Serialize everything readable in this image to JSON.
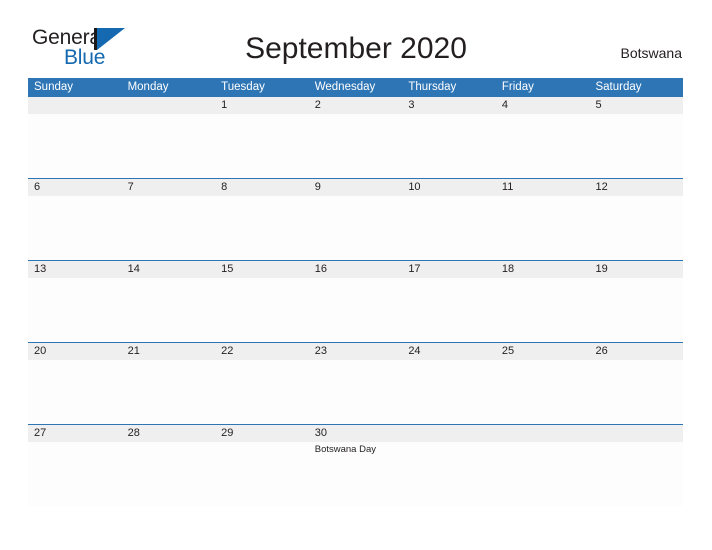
{
  "logo": {
    "word1": "General",
    "word2": "Blue",
    "mark": "triangle-mark",
    "color_dark": "#231f20",
    "color_blue": "#1469b0"
  },
  "header": {
    "title": "September 2020",
    "region": "Botswana"
  },
  "calendar": {
    "accent_color": "#2e75b6",
    "date_band_color": "#efefef",
    "day_names": [
      "Sunday",
      "Monday",
      "Tuesday",
      "Wednesday",
      "Thursday",
      "Friday",
      "Saturday"
    ],
    "weeks": [
      {
        "days": [
          {
            "date": "",
            "event": ""
          },
          {
            "date": "",
            "event": ""
          },
          {
            "date": "1",
            "event": ""
          },
          {
            "date": "2",
            "event": ""
          },
          {
            "date": "3",
            "event": ""
          },
          {
            "date": "4",
            "event": ""
          },
          {
            "date": "5",
            "event": ""
          }
        ]
      },
      {
        "days": [
          {
            "date": "6",
            "event": ""
          },
          {
            "date": "7",
            "event": ""
          },
          {
            "date": "8",
            "event": ""
          },
          {
            "date": "9",
            "event": ""
          },
          {
            "date": "10",
            "event": ""
          },
          {
            "date": "11",
            "event": ""
          },
          {
            "date": "12",
            "event": ""
          }
        ]
      },
      {
        "days": [
          {
            "date": "13",
            "event": ""
          },
          {
            "date": "14",
            "event": ""
          },
          {
            "date": "15",
            "event": ""
          },
          {
            "date": "16",
            "event": ""
          },
          {
            "date": "17",
            "event": ""
          },
          {
            "date": "18",
            "event": ""
          },
          {
            "date": "19",
            "event": ""
          }
        ]
      },
      {
        "days": [
          {
            "date": "20",
            "event": ""
          },
          {
            "date": "21",
            "event": ""
          },
          {
            "date": "22",
            "event": ""
          },
          {
            "date": "23",
            "event": ""
          },
          {
            "date": "24",
            "event": ""
          },
          {
            "date": "25",
            "event": ""
          },
          {
            "date": "26",
            "event": ""
          }
        ]
      },
      {
        "days": [
          {
            "date": "27",
            "event": ""
          },
          {
            "date": "28",
            "event": ""
          },
          {
            "date": "29",
            "event": ""
          },
          {
            "date": "30",
            "event": "Botswana Day"
          },
          {
            "date": "",
            "event": ""
          },
          {
            "date": "",
            "event": ""
          },
          {
            "date": "",
            "event": ""
          }
        ]
      }
    ]
  }
}
